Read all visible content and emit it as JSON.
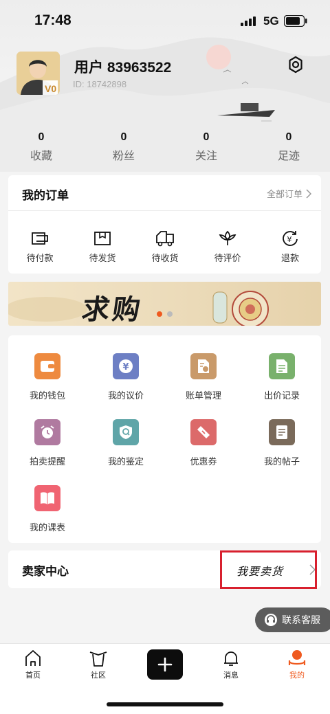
{
  "status_bar": {
    "time": "17:48",
    "network": "5G"
  },
  "profile": {
    "username": "用户 83963522",
    "user_id": "ID: 18742898",
    "avatar_badge": "V0"
  },
  "stats": [
    {
      "value": "0",
      "label": "收藏"
    },
    {
      "value": "0",
      "label": "粉丝"
    },
    {
      "value": "0",
      "label": "关注"
    },
    {
      "value": "0",
      "label": "足迹"
    }
  ],
  "orders": {
    "title": "我的订单",
    "all_link": "全部订单",
    "items": [
      {
        "label": "待付款",
        "icon": "wallet-icon"
      },
      {
        "label": "待发货",
        "icon": "box-icon"
      },
      {
        "label": "待收货",
        "icon": "truck-icon"
      },
      {
        "label": "待评价",
        "icon": "flower-icon"
      },
      {
        "label": "退款",
        "icon": "refund-icon"
      }
    ]
  },
  "banner": {
    "text": "求购",
    "active_dot": 0
  },
  "services": [
    {
      "label": "我的钱包",
      "icon": "wallet-icon",
      "color": "#ee8a3f"
    },
    {
      "label": "我的议价",
      "icon": "yen-icon",
      "color": "#6d7fc4"
    },
    {
      "label": "账单管理",
      "icon": "bill-icon",
      "color": "#c99a6a"
    },
    {
      "label": "出价记录",
      "icon": "document-icon",
      "color": "#79b16c"
    },
    {
      "label": "拍卖提醒",
      "icon": "alarm-icon",
      "color": "#b07aa0"
    },
    {
      "label": "我的鉴定",
      "icon": "shield-search-icon",
      "color": "#5fa5a8"
    },
    {
      "label": "优惠券",
      "icon": "coupon-icon",
      "color": "#dc6a6a"
    },
    {
      "label": "我的帖子",
      "icon": "post-icon",
      "color": "#7a6a5a"
    },
    {
      "label": "我的课表",
      "icon": "book-icon",
      "color": "#f06472"
    }
  ],
  "seller": {
    "title": "卖家中心",
    "action": "我要卖货"
  },
  "customer_service": {
    "label": "联系客服"
  },
  "tabbar": [
    {
      "label": "首页",
      "icon": "home-icon"
    },
    {
      "label": "社区",
      "icon": "community-icon"
    },
    {
      "label": "消息",
      "icon": "bell-icon"
    },
    {
      "label": "我的",
      "icon": "profile-icon"
    }
  ],
  "colors": {
    "accent": "#ef5a1f",
    "highlight": "#d8202e"
  }
}
